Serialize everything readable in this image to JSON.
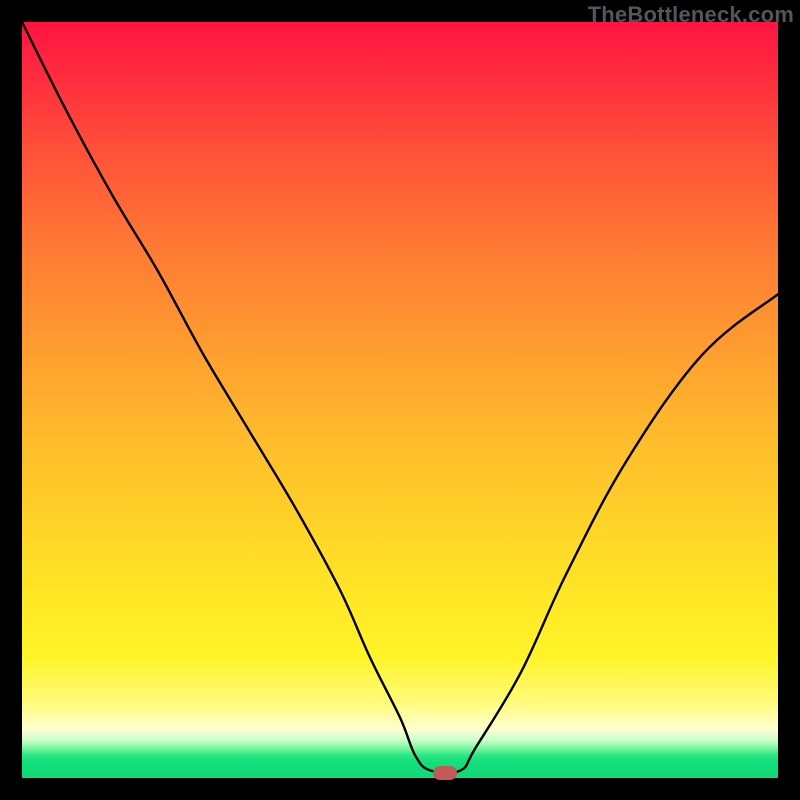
{
  "watermark": "TheBottleneck.com",
  "chart_data": {
    "type": "line",
    "title": "",
    "xlabel": "",
    "ylabel": "",
    "xlim": [
      0,
      100
    ],
    "ylim": [
      0,
      100
    ],
    "grid": false,
    "legend": false,
    "background_gradient": {
      "top_color": "#ff1440",
      "bottom_color": "#10d878",
      "description": "vertical red→orange→yellow→green gradient"
    },
    "series": [
      {
        "name": "bottleneck-curve",
        "color": "#000000",
        "x": [
          0,
          6,
          12,
          18,
          24,
          30,
          36,
          42,
          46,
          50,
          52,
          54,
          58,
          60,
          66,
          72,
          80,
          90,
          100
        ],
        "values": [
          100,
          88,
          77,
          67,
          56,
          46,
          36,
          25,
          16,
          8,
          3,
          1,
          1,
          4,
          14,
          27,
          42,
          56,
          64
        ]
      }
    ],
    "marker": {
      "name": "optimal-point",
      "x": 56,
      "y": 0.7,
      "color": "#c35a57"
    }
  }
}
